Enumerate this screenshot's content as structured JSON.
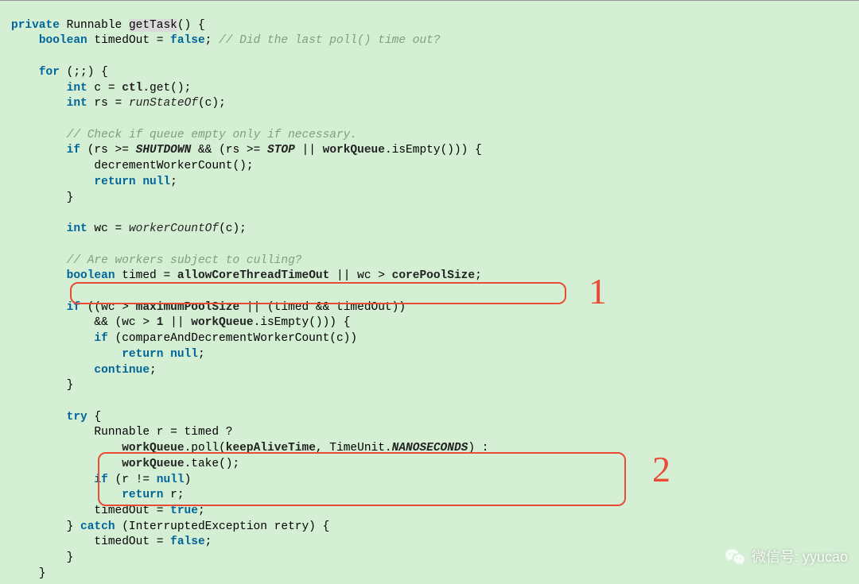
{
  "code": {
    "l1a": "private",
    "l1b": " Runnable ",
    "l1c": "getTask",
    "l1d": "() {",
    "l2a": "    ",
    "l2b": "boolean",
    "l2c": " timedOut = ",
    "l2d": "false",
    "l2e": "; ",
    "l2f": "// Did the last poll() time out?",
    "l3": "",
    "l4a": "    ",
    "l4b": "for",
    "l4c": " (;;) {",
    "l5a": "        ",
    "l5b": "int",
    "l5c": " c = ",
    "l5d": "ctl",
    "l5e": ".get();",
    "l6a": "        ",
    "l6b": "int",
    "l6c": " rs = ",
    "l6d": "runStateOf",
    "l6e": "(c);",
    "l7": "",
    "l8a": "        ",
    "l8b": "// Check if queue empty only if necessary.",
    "l9a": "        ",
    "l9b": "if",
    "l9c": " (rs >= ",
    "l9d": "SHUTDOWN",
    "l9e": " && (rs >= ",
    "l9f": "STOP",
    "l9g": " || ",
    "l9h": "workQueue",
    "l9i": ".isEmpty())) {",
    "l10": "            decrementWorkerCount();",
    "l11a": "            ",
    "l11b": "return null",
    "l11c": ";",
    "l12": "        }",
    "l13": "",
    "l14a": "        ",
    "l14b": "int",
    "l14c": " wc = ",
    "l14d": "workerCountOf",
    "l14e": "(c);",
    "l15": "",
    "l16a": "        ",
    "l16b": "// Are workers subject to culling?",
    "l17a": "        ",
    "l17b": "boolean",
    "l17c": " timed = ",
    "l17d": "allowCoreThreadTimeOut",
    "l17e": " || wc > ",
    "l17f": "corePoolSize",
    "l17g": ";",
    "l18": "",
    "l19a": "        ",
    "l19b": "if",
    "l19c": " ((wc > ",
    "l19d": "maximumPoolSize",
    "l19e": " || (timed && timedOut))",
    "l20a": "            && (wc > ",
    "l20b": "1",
    "l20c": " || ",
    "l20d": "workQueue",
    "l20e": ".isEmpty())) {",
    "l21a": "            ",
    "l21b": "if",
    "l21c": " (compareAndDecrementWorkerCount(c))",
    "l22a": "                ",
    "l22b": "return null",
    "l22c": ";",
    "l23a": "            ",
    "l23b": "continue",
    "l23c": ";",
    "l24": "        }",
    "l25": "",
    "l26a": "        ",
    "l26b": "try",
    "l26c": " {",
    "l27": "            Runnable r = timed ?",
    "l28a": "                ",
    "l28b": "workQueue",
    "l28c": ".poll(",
    "l28d": "keepAliveTime",
    "l28e": ", TimeUnit.",
    "l28f": "NANOSECONDS",
    "l28g": ") :",
    "l29a": "                ",
    "l29b": "workQueue",
    "l29c": ".take();",
    "l30a": "            ",
    "l30b": "if",
    "l30c": " (r != ",
    "l30d": "null",
    "l30e": ")",
    "l31a": "                ",
    "l31b": "return",
    "l31c": " r;",
    "l32a": "            timedOut = ",
    "l32b": "true",
    "l32c": ";",
    "l33a": "        } ",
    "l33b": "catch",
    "l33c": " (InterruptedException retry) {",
    "l34a": "            timedOut = ",
    "l34b": "false",
    "l34c": ";",
    "l35": "        }",
    "l36": "    }"
  },
  "annotations": {
    "a1": "1",
    "a2": "2"
  },
  "watermark": {
    "label": "微信号: yyucao"
  }
}
